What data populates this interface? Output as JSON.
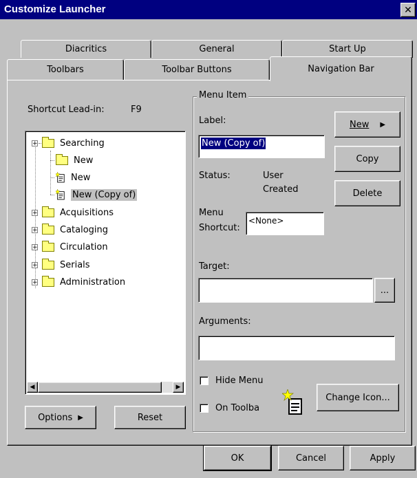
{
  "window": {
    "title": "Customize Launcher"
  },
  "tabs": {
    "row1": [
      "Diacritics",
      "General",
      "Start Up"
    ],
    "row2": [
      "Toolbars",
      "Toolbar Buttons",
      "Navigation Bar"
    ],
    "active": "Navigation Bar"
  },
  "shortcut": {
    "label": "Shortcut Lead-in:",
    "value": "F9"
  },
  "tree": {
    "items": [
      {
        "label": "Searching",
        "type": "folder",
        "expander": "+"
      },
      {
        "label": "New",
        "type": "folder",
        "expander": ""
      },
      {
        "label": "New",
        "type": "document",
        "expander": ""
      },
      {
        "label": "New (Copy of)",
        "type": "document",
        "expander": "",
        "selected": true
      },
      {
        "label": "Acquisitions",
        "type": "folder",
        "expander": "+"
      },
      {
        "label": "Cataloging",
        "type": "folder",
        "expander": "+"
      },
      {
        "label": "Circulation",
        "type": "folder",
        "expander": "+"
      },
      {
        "label": "Serials",
        "type": "folder",
        "expander": "+"
      },
      {
        "label": "Administration",
        "type": "folder",
        "expander": "+"
      }
    ]
  },
  "left_buttons": {
    "options": "Options",
    "reset": "Reset"
  },
  "menu_item": {
    "group_label": "Menu Item",
    "label_caption": "Label:",
    "label_value": "New (Copy of)",
    "status_caption": "Status:",
    "status_value_1": "User",
    "status_value_2": "Created",
    "shortcut_caption_1": "Menu",
    "shortcut_caption_2": "Shortcut:",
    "shortcut_value": "<None>",
    "target_caption": "Target:",
    "target_value": "",
    "browse_label": "...",
    "arguments_caption": "Arguments:",
    "arguments_value": "",
    "hide_menu_label": "Hide Menu",
    "on_toolbar_label": "On Toolba",
    "change_icon_label": "Change Icon..."
  },
  "side_buttons": {
    "new": "New",
    "copy": "Copy",
    "delete": "Delete"
  },
  "footer": {
    "ok": "OK",
    "cancel": "Cancel",
    "apply": "Apply"
  }
}
